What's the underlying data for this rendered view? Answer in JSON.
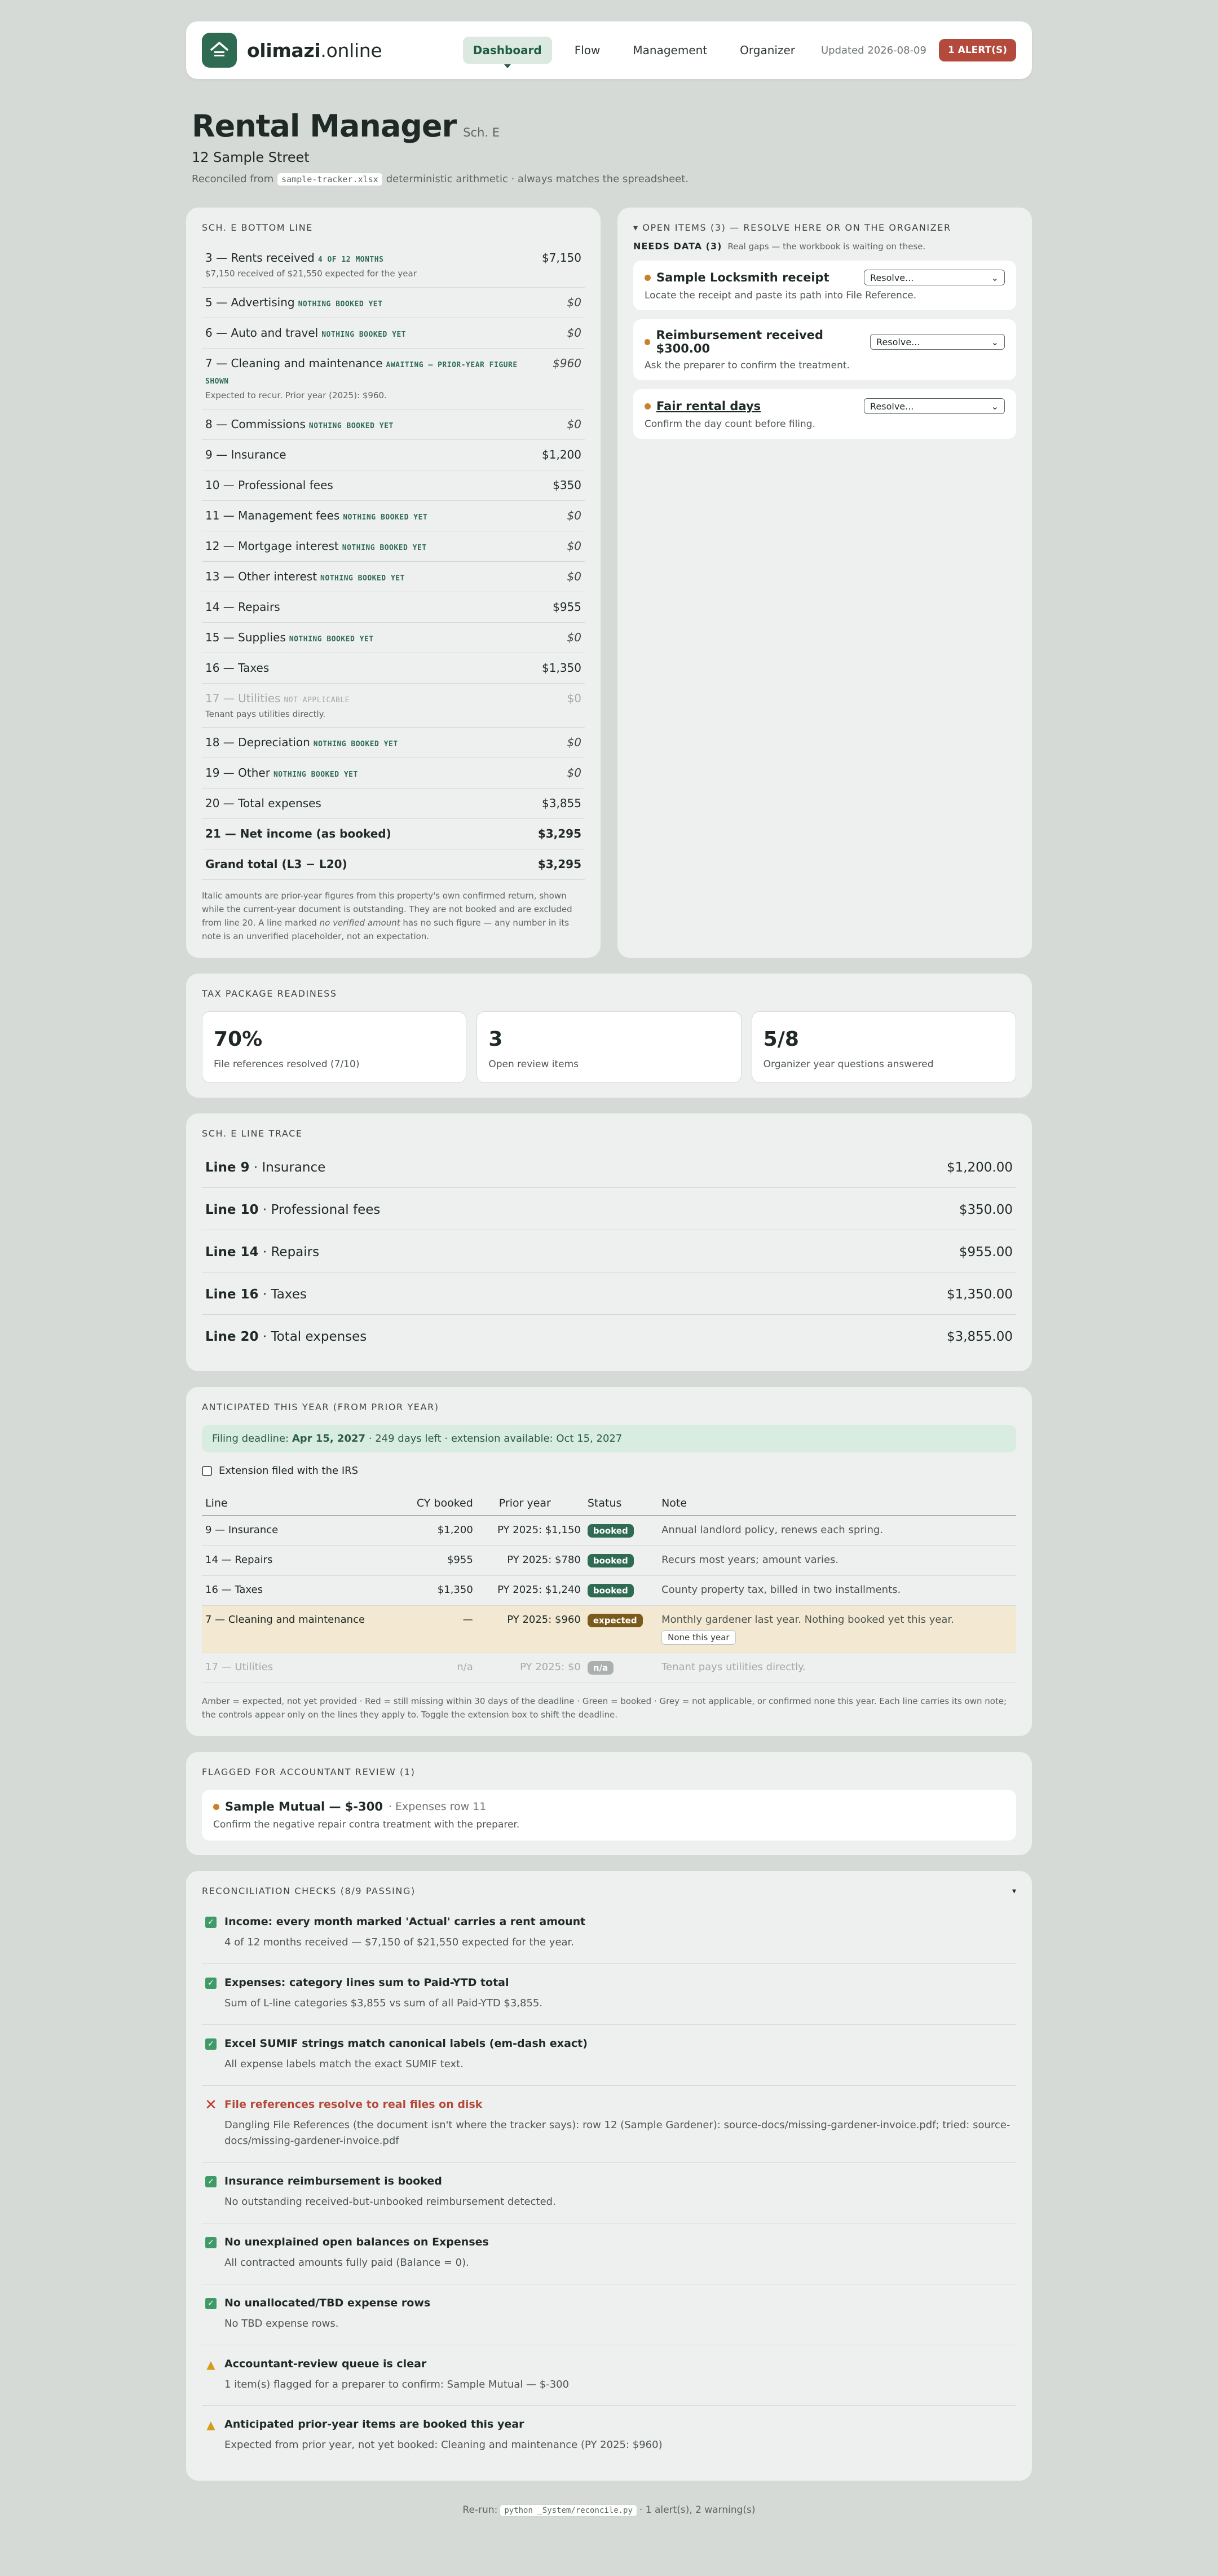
{
  "header": {
    "brand_bold": "olimazi",
    "brand_rest": ".online",
    "nav": [
      "Dashboard",
      "Flow",
      "Management",
      "Organizer"
    ],
    "updated": "Updated 2026-08-09",
    "alert": "1 ALERT(S)"
  },
  "page": {
    "title": "Rental Manager",
    "title_tag": "Sch. E",
    "street": "12 Sample Street",
    "recon_pre": "Reconciled from",
    "recon_file": "sample-tracker.xlsx",
    "recon_post": "deterministic arithmetic · always matches the spreadsheet."
  },
  "sche": {
    "title": "SCH. E BOTTOM LINE",
    "lines": [
      {
        "label": "3 — Rents received",
        "tag": "4 OF 12 MONTHS",
        "sub": "$7,150 received of $21,550 expected for the year",
        "amount": "$7,150"
      },
      {
        "label": "5 — Advertising",
        "tag": "NOTHING BOOKED YET",
        "sub": "",
        "amount": "$0"
      },
      {
        "label": "6 — Auto and travel",
        "tag": "NOTHING BOOKED YET",
        "sub": "",
        "amount": "$0"
      },
      {
        "label": "7 — Cleaning and maintenance",
        "tag": "AWAITING — PRIOR-YEAR FIGURE SHOWN",
        "sub": "Expected to recur. Prior year (2025): $960.",
        "amount": "$960"
      },
      {
        "label": "8 — Commissions",
        "tag": "NOTHING BOOKED YET",
        "sub": "",
        "amount": "$0"
      },
      {
        "label": "9 — Insurance",
        "tag": "",
        "sub": "",
        "amount": "$1,200"
      },
      {
        "label": "10 — Professional fees",
        "tag": "",
        "sub": "",
        "amount": "$350"
      },
      {
        "label": "11 — Management fees",
        "tag": "NOTHING BOOKED YET",
        "sub": "",
        "amount": "$0"
      },
      {
        "label": "12 — Mortgage interest",
        "tag": "NOTHING BOOKED YET",
        "sub": "",
        "amount": "$0"
      },
      {
        "label": "13 — Other interest",
        "tag": "NOTHING BOOKED YET",
        "sub": "",
        "amount": "$0"
      },
      {
        "label": "14 — Repairs",
        "tag": "",
        "sub": "",
        "amount": "$955"
      },
      {
        "label": "15 — Supplies",
        "tag": "NOTHING BOOKED YET",
        "sub": "",
        "amount": "$0"
      },
      {
        "label": "16 — Taxes",
        "tag": "",
        "sub": "",
        "amount": "$1,350"
      },
      {
        "label": "17 — Utilities",
        "tag": "NOT APPLICABLE",
        "sub": "Tenant pays utilities directly.",
        "amount": "$0"
      },
      {
        "label": "18 — Depreciation",
        "tag": "NOTHING BOOKED YET",
        "sub": "",
        "amount": "$0"
      },
      {
        "label": "19 — Other",
        "tag": "NOTHING BOOKED YET",
        "sub": "",
        "amount": "$0"
      },
      {
        "label": "20 — Total expenses",
        "tag": "",
        "sub": "",
        "amount": "$3,855"
      },
      {
        "label": "21 — Net income (as booked)",
        "tag": "",
        "sub": "",
        "amount": "$3,295"
      },
      {
        "label": "Grand total (L3 − L20)",
        "tag": "",
        "sub": "",
        "amount": "$3,295"
      }
    ],
    "footnote_a": "Italic amounts are prior-year figures from this property's own confirmed return, shown while the current-year document is outstanding. They are not booked and are excluded from line 20. A line marked ",
    "footnote_em": "no verified amount",
    "footnote_b": " has no such figure — any number in its note is an unverified placeholder, not an expectation."
  },
  "open": {
    "title": "▾ OPEN ITEMS (3) — RESOLVE HERE OR ON THE ORGANIZER",
    "needs": "NEEDS DATA (3)",
    "needs_sub": "Real gaps — the workbook is waiting on these.",
    "select_label": "Resolve...",
    "items": [
      {
        "title": "Sample Locksmith receipt",
        "desc": "Locate the receipt and paste its path into File Reference."
      },
      {
        "title": "Reimbursement received $300.00",
        "desc": "Ask the preparer to confirm the treatment."
      },
      {
        "title": "Fair rental days",
        "desc": "Confirm the day count before filing."
      }
    ]
  },
  "readiness": {
    "title": "TAX PACKAGE READINESS",
    "cards": [
      {
        "num": "70%",
        "label": "File references resolved (7/10)"
      },
      {
        "num": "3",
        "label": "Open review items"
      },
      {
        "num": "5/8",
        "label": "Organizer year questions answered"
      }
    ]
  },
  "trace": {
    "title": "SCH. E LINE TRACE",
    "rows": [
      {
        "line": "Line 9",
        "name": " · Insurance",
        "amount": "$1,200.00"
      },
      {
        "line": "Line 10",
        "name": " · Professional fees",
        "amount": "$350.00"
      },
      {
        "line": "Line 14",
        "name": " · Repairs",
        "amount": "$955.00"
      },
      {
        "line": "Line 16",
        "name": " · Taxes",
        "amount": "$1,350.00"
      },
      {
        "line": "Line 20",
        "name": " · Total expenses",
        "amount": "$3,855.00"
      }
    ]
  },
  "anticipated": {
    "title": "ANTICIPATED THIS YEAR (FROM PRIOR YEAR)",
    "deadline_pre": "Filing deadline: ",
    "deadline_date": "Apr 15, 2027",
    "deadline_post": " · 249 days left · extension available: Oct 15, 2027",
    "extension": "Extension filed with the IRS",
    "headers": [
      "Line",
      "CY booked",
      "Prior year",
      "Status",
      "Note"
    ],
    "rows": [
      {
        "line": "9 — Insurance",
        "cy": "$1,200",
        "py": "PY 2025: $1,150",
        "status": "booked",
        "note": "Annual landlord policy, renews each spring."
      },
      {
        "line": "14 — Repairs",
        "cy": "$955",
        "py": "PY 2025: $780",
        "status": "booked",
        "note": "Recurs most years; amount varies."
      },
      {
        "line": "16 — Taxes",
        "cy": "$1,350",
        "py": "PY 2025: $1,240",
        "status": "booked",
        "note": "County property tax, billed in two installments."
      },
      {
        "line": "7 — Cleaning and maintenance",
        "cy": "—",
        "py": "PY 2025: $960",
        "status": "expected",
        "note": "Monthly gardener last year. Nothing booked yet this year.",
        "button": "None this year"
      },
      {
        "line": "17 — Utilities",
        "cy": "n/a",
        "py": "PY 2025: $0",
        "status": "n/a",
        "note": "Tenant pays utilities directly."
      }
    ],
    "legend": "Amber = expected, not yet provided · Red = still missing within 30 days of the deadline · Green = booked · Grey = not applicable, or confirmed none this year. Each line carries its own note; the controls appear only on the lines they apply to. Toggle the extension box to shift the deadline."
  },
  "flagged": {
    "title": "FLAGGED FOR ACCOUNTANT REVIEW (1)",
    "item_title": "Sample Mutual — $-300",
    "item_row": "· Expenses row 11",
    "item_desc": "Confirm the negative repair contra treatment with the preparer."
  },
  "checks": {
    "title": "RECONCILIATION CHECKS (8/9 PASSING)",
    "toggle": "▾",
    "rows": [
      {
        "status": "ok",
        "title": "Income: every month marked 'Actual' carries a rent amount",
        "desc": "4 of 12 months received — $7,150 of $21,550 expected for the year."
      },
      {
        "status": "ok",
        "title": "Expenses: category lines sum to Paid-YTD total",
        "desc": "Sum of L-line categories $3,855 vs sum of all Paid-YTD $3,855."
      },
      {
        "status": "ok",
        "title": "Excel SUMIF strings match canonical labels (em-dash exact)",
        "desc": "All expense labels match the exact SUMIF text."
      },
      {
        "status": "fail",
        "title": "File references resolve to real files on disk",
        "desc": "Dangling File References (the document isn't where the tracker says): row 12 (Sample Gardener): source-docs/missing-gardener-invoice.pdf; tried: source-docs/missing-gardener-invoice.pdf"
      },
      {
        "status": "ok",
        "title": "Insurance reimbursement is booked",
        "desc": "No outstanding received-but-unbooked reimbursement detected."
      },
      {
        "status": "ok",
        "title": "No unexplained open balances on Expenses",
        "desc": "All contracted amounts fully paid (Balance = 0)."
      },
      {
        "status": "ok",
        "title": "No unallocated/TBD expense rows",
        "desc": "No TBD expense rows."
      },
      {
        "status": "warn",
        "title": "Accountant-review queue is clear",
        "desc": "1 item(s) flagged for a preparer to confirm: Sample Mutual — $-300"
      },
      {
        "status": "warn",
        "title": "Anticipated prior-year items are booked this year",
        "desc": "Expected from prior year, not yet booked: Cleaning and maintenance (PY 2025: $960)"
      }
    ]
  },
  "footer": {
    "pre": "Re-run:",
    "code": "python _System/reconcile.py",
    "post": "· 1 alert(s), 2 warning(s)"
  },
  "colors": {
    "accent": "#2f6b53",
    "alert": "#b34a3c",
    "warn": "#d79b1c",
    "expected": "#7b5b1c"
  }
}
